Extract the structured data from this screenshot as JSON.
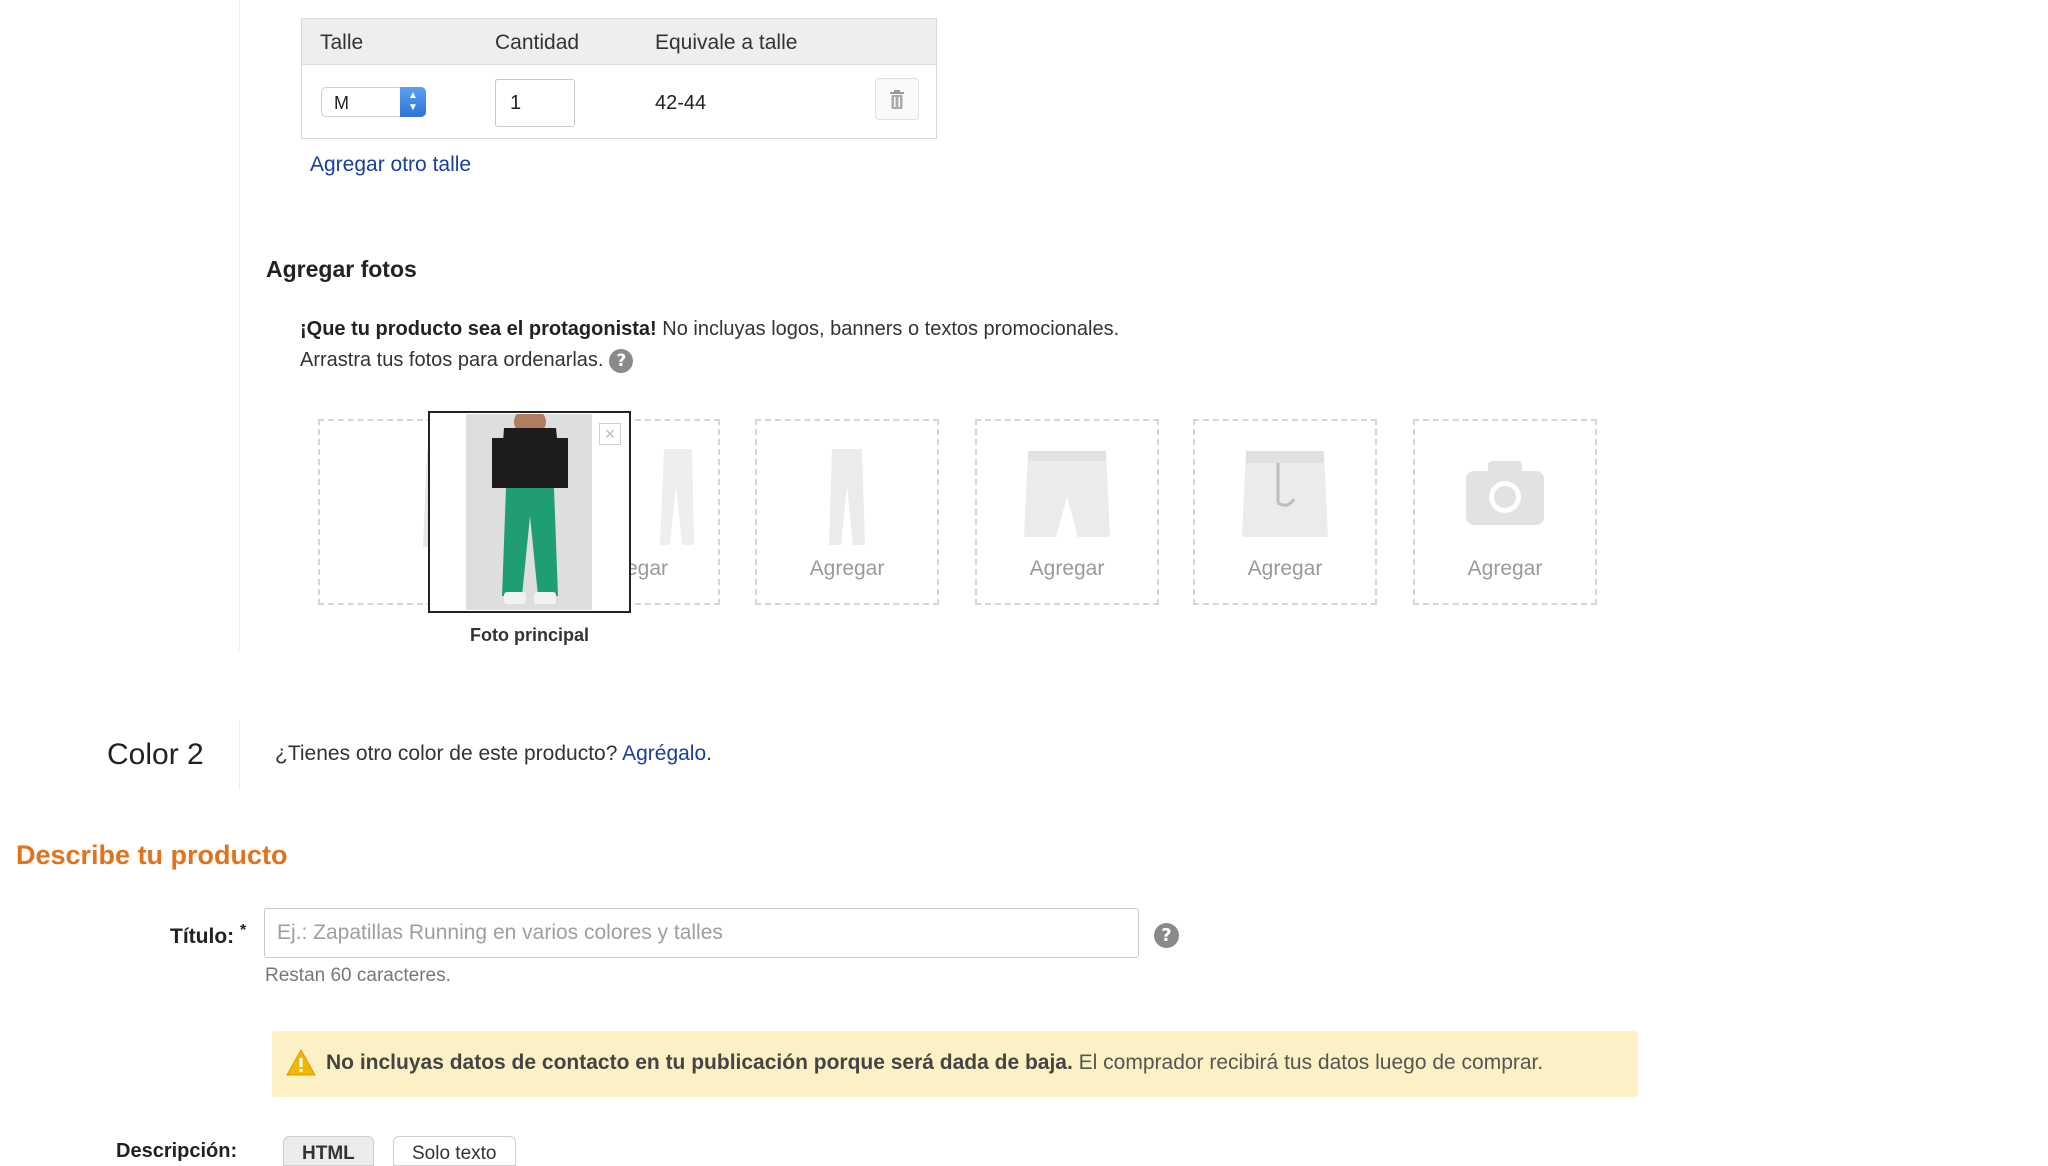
{
  "size_table": {
    "headers": [
      "Talle",
      "Cantidad",
      "Equivale a talle"
    ],
    "row": {
      "size": "M",
      "quantity": "1",
      "equivalent": "42-44"
    },
    "add_link": "Agregar otro talle"
  },
  "photos": {
    "title": "Agregar fotos",
    "hint_bold": "¡Que tu producto sea el protagonista!",
    "hint_rest": " No incluyas logos, banners o textos promocionales.",
    "hint_line2": "Arrastra tus fotos para ordenarlas.",
    "help_glyph": "?",
    "slot_label": "Agregar",
    "slots": [
      {
        "label": "",
        "icon": "pants-front-icon"
      },
      {
        "label": "Agregar",
        "icon": "pants-side-icon"
      },
      {
        "label": "Agregar",
        "icon": "pants-back-icon"
      },
      {
        "label": "Agregar",
        "icon": "pants-detail-icon"
      },
      {
        "label": "Agregar",
        "icon": "pants-waist-icon"
      },
      {
        "label": "Agregar",
        "icon": "camera-icon"
      }
    ],
    "main_caption": "Foto principal",
    "close_glyph": "×"
  },
  "color2": {
    "label": "Color 2",
    "question": "¿Tienes otro color de este producto? ",
    "link": "Agrégalo",
    "suffix": "."
  },
  "describe": {
    "title": "Describe tu producto",
    "title_label": "Título:",
    "required_mark": "*",
    "title_placeholder": "Ej.: Zapatillas Running en varios colores y talles",
    "title_value": "",
    "help_glyph": "?",
    "remaining": "Restan 60 caracteres.",
    "warning_bold": "No incluyas datos de contacto en tu publicación porque será dada de baja.",
    "warning_rest": " El comprador recibirá tus datos luego de comprar.",
    "description_label": "Descripción:",
    "tabs": [
      "HTML",
      "Solo texto"
    ]
  },
  "colors": {
    "link": "#1a3e9c",
    "accent": "#e0731e",
    "warning_bg": "#fcf1c5",
    "select_blue": "#2f73d8"
  }
}
